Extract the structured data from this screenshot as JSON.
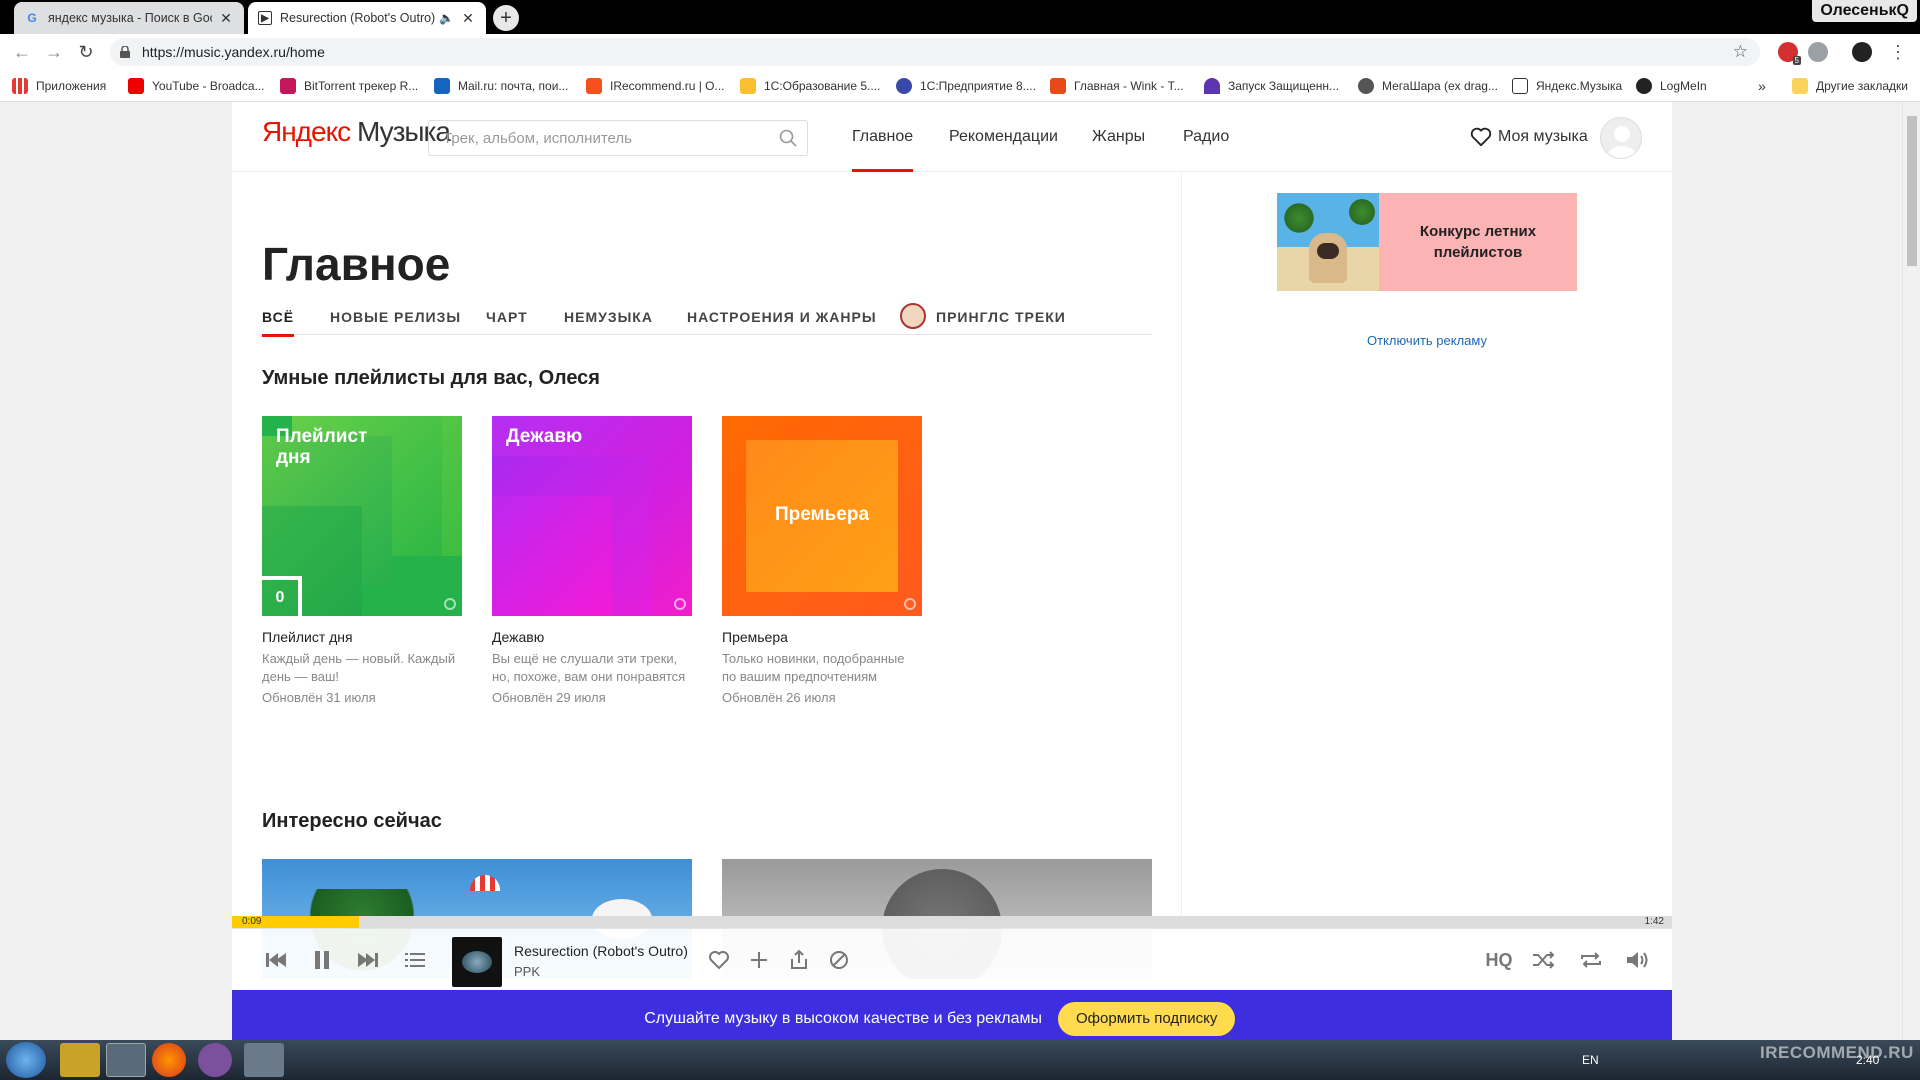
{
  "browser": {
    "tabs": [
      {
        "title": "яндекс музыка - Поиск в Googl",
        "favicon": "G"
      },
      {
        "title": "Resurection (Robot's Outro)",
        "favicon": "▶"
      }
    ],
    "profile_name": "ОлесенькQ",
    "url": "https://music.yandex.ru/home",
    "bookmarks": [
      "Приложения",
      "YouTube - Broadca...",
      "BitTorrent трекер R...",
      "Mail.ru: почта, пои...",
      "IRecommend.ru | О...",
      "1С:Образование 5....",
      "1С:Предприятие 8....",
      "Главная - Wink - Т...",
      "Запуск Защищенн...",
      "МегаШара (ex drag...",
      "Яндекс.Музыка",
      "LogMeIn",
      "»",
      "Другие закладки"
    ],
    "ext_badge": "5"
  },
  "site": {
    "logo": {
      "part1": "Яндекс",
      "part2": " Музыка"
    },
    "search_placeholder": "Трек, альбом, исполнитель",
    "nav": [
      "Главное",
      "Рекомендации",
      "Жанры",
      "Радио"
    ],
    "my_music": "Моя музыка"
  },
  "main": {
    "title": "Главное",
    "subtabs": [
      "ВСЁ",
      "НОВЫЕ РЕЛИЗЫ",
      "ЧАРТ",
      "НЕМУЗЫКА",
      "НАСТРОЕНИЯ И ЖАНРЫ",
      "ПРИНГЛС ТРЕКИ"
    ],
    "smart_title": "Умные плейлисты для вас, Олеся",
    "cards": [
      {
        "cover_label": "Плейлист\nдня",
        "badge": "0",
        "title": "Плейлист дня",
        "desc": "Каждый день — новый. Каждый день — ваш!",
        "date": "Обновлён 31 июля"
      },
      {
        "cover_label": "Дежавю",
        "title": "Дежавю",
        "desc": "Вы ещё не слушали эти треки, но, похоже, вам они понравятся",
        "date": "Обновлён 29 июля"
      },
      {
        "cover_label": "Премьера",
        "title": "Премьера",
        "desc": "Только новинки, подобранные по вашим предпочтениям",
        "date": "Обновлён 26 июля"
      }
    ],
    "interesting_title": "Интересно сейчас"
  },
  "sidebar": {
    "ad_text": "Конкурс летних плейлистов",
    "disable_ads": "Отключить рекламу"
  },
  "player": {
    "time_current": "0:09",
    "time_total": "1:42",
    "progress": 0.088,
    "track_title": "Resurection (Robot's Outro)",
    "artist": "PPK",
    "hq_label": "HQ"
  },
  "promo": {
    "text": "Слушайте музыку в высоком качестве и без рекламы",
    "button": "Оформить подписку"
  },
  "taskbar": {
    "lang": "EN",
    "time": "2:40"
  },
  "watermark": "IRECOMMEND.RU"
}
